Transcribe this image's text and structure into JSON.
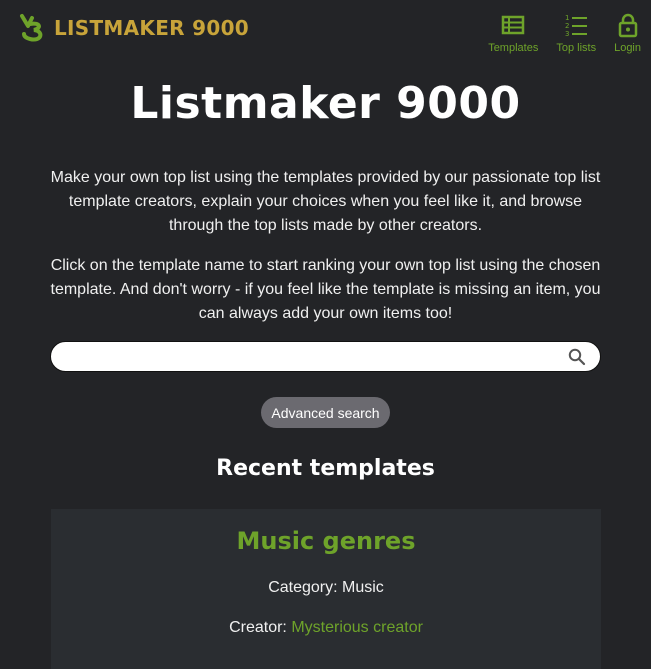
{
  "header": {
    "logo_text": "LISTMAKER 9000",
    "nav": [
      {
        "label": "Templates",
        "icon": "templates-icon"
      },
      {
        "label": "Top lists",
        "icon": "top-lists-icon"
      },
      {
        "label": "Login",
        "icon": "lock-icon"
      }
    ]
  },
  "main": {
    "title": "Listmaker 9000",
    "intro1": "Make your own top list using the templates provided by our passionate top list template creators, explain your choices when you feel like it, and browse through the top lists made by other creators.",
    "intro2": "Click on the template name to start ranking your own top list using the chosen template. And don't worry - if you feel like the template is missing an item, you can always add your own items too!",
    "search": {
      "value": "",
      "placeholder": ""
    },
    "advanced_search_label": "Advanced search",
    "recent_title": "Recent templates"
  },
  "cards": [
    {
      "title": "Music genres",
      "category_label": "Category:",
      "category": "Music",
      "creator_label": "Creator:",
      "creator": "Mysterious creator"
    }
  ],
  "colors": {
    "background": "#232427",
    "accent": "#6ea32a",
    "logo": "#c8a43a",
    "card": "#2a2d31",
    "button": "#6b6a70"
  }
}
